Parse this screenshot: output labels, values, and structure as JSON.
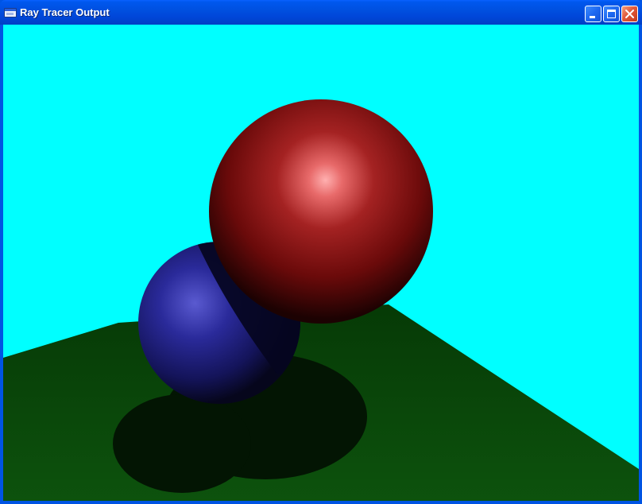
{
  "window": {
    "title": "Ray Tracer Output",
    "icons": {
      "app": "app-window-icon",
      "minimize": "minimize-icon",
      "maximize": "maximize-icon",
      "close": "close-icon"
    }
  },
  "scene": {
    "colors": {
      "sky": "#00ffff",
      "floor": "#0a4a0a",
      "red_sphere": "#8a1010",
      "blue_sphere": "#1a1a7a",
      "shadow": "#031503"
    },
    "objects": [
      "floor-plane",
      "red-sphere",
      "blue-sphere"
    ]
  }
}
